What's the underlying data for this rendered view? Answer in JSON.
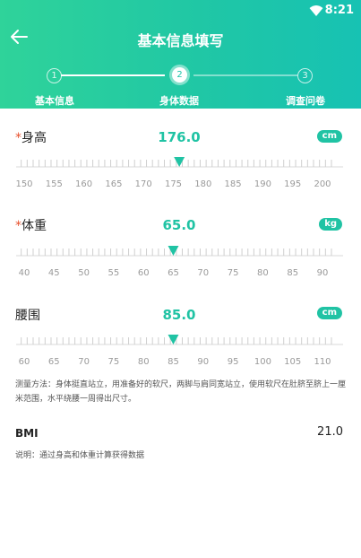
{
  "status": {
    "time": "8:21"
  },
  "header": {
    "title": "基本信息填写"
  },
  "steps": [
    {
      "num": "1",
      "label": "基本信息"
    },
    {
      "num": "2",
      "label": "身体数据"
    },
    {
      "num": "3",
      "label": "调查问卷"
    }
  ],
  "height": {
    "star": "*",
    "label": "身高",
    "value": "176.0",
    "unit": "cm",
    "min": 150,
    "max": 200,
    "selected": 176,
    "ticks": [
      "150",
      "155",
      "160",
      "165",
      "170",
      "175",
      "180",
      "185",
      "190",
      "195",
      "200"
    ]
  },
  "weight": {
    "star": "*",
    "label": "体重",
    "value": "65.0",
    "unit": "kg",
    "min": 40,
    "max": 90,
    "selected": 65,
    "ticks": [
      "40",
      "45",
      "50",
      "55",
      "60",
      "65",
      "70",
      "75",
      "80",
      "85",
      "90"
    ]
  },
  "waist": {
    "label": "腰围",
    "value": "85.0",
    "unit": "cm",
    "min": 60,
    "max": 110,
    "selected": 85,
    "ticks": [
      "60",
      "65",
      "70",
      "75",
      "80",
      "85",
      "90",
      "95",
      "100",
      "105",
      "110"
    ]
  },
  "note": "测量方法：身体挺直站立，用准备好的软尺，两脚与肩同宽站立，使用软尺在肚脐至脐上一厘米范围，水平绕腰一周得出尺寸。",
  "bmi": {
    "label": "BMI",
    "value": "21.0",
    "desc": "说明：通过身高和体重计算获得数据"
  },
  "colors": {
    "accent": "#20c3a4",
    "star": "#e8502c"
  }
}
